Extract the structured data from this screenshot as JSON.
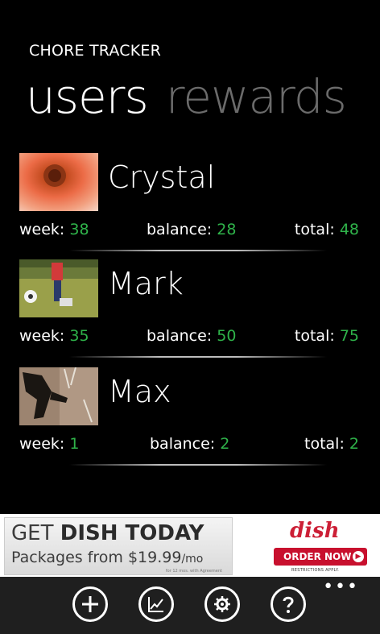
{
  "app": {
    "title": "CHORE TRACKER"
  },
  "pivot": {
    "active": "users",
    "inactive": "rewards"
  },
  "users": [
    {
      "name": "Crystal",
      "week_label": "week:",
      "week": "38",
      "balance_label": "balance:",
      "balance": "28",
      "total_label": "total:",
      "total": "48",
      "photo": "flower-photo"
    },
    {
      "name": "Mark",
      "week_label": "week:",
      "week": "35",
      "balance_label": "balance:",
      "balance": "50",
      "total_label": "total:",
      "total": "75",
      "photo": "soccer-photo"
    },
    {
      "name": "Max",
      "week_label": "week:",
      "week": "1",
      "balance_label": "balance:",
      "balance": "2",
      "total_label": "total:",
      "total": "2",
      "photo": "shadow-photo"
    }
  ],
  "ad": {
    "headline_pre": "GET ",
    "headline_bold": "DISH TODAY",
    "sub_pre": "Packages from ",
    "sub_price": "$19.99",
    "sub_unit": "/mo",
    "fine_print": "for 12 mos. with Agreement",
    "brand": "dish",
    "cta": "ORDER NOW",
    "legal": "RESTRICTIONS APPLY."
  },
  "appbar": {
    "buttons": [
      "add-icon",
      "chart-icon",
      "settings-icon",
      "help-icon"
    ],
    "more": "•••"
  },
  "colors": {
    "accent": "#2fb34a",
    "inactive": "#6b6b6b",
    "appbar": "#1f1f1f"
  }
}
